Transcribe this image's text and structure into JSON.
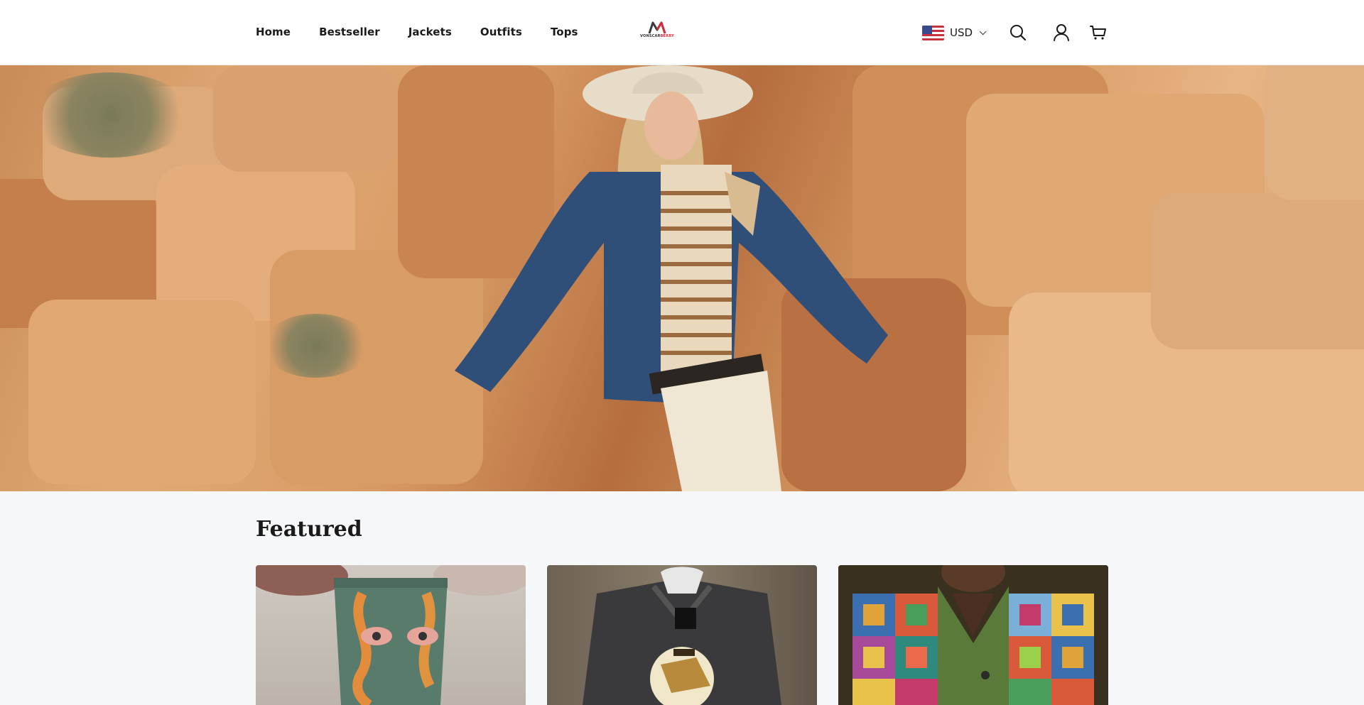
{
  "header": {
    "nav": [
      "Home",
      "Bestseller",
      "Jackets",
      "Outfits",
      "Tops"
    ],
    "logo": {
      "text_dark": "VONSCAR",
      "text_red": "BERRY",
      "mark": "M"
    },
    "currency": {
      "label": "USD",
      "flag": "us-flag-icon"
    },
    "icons": [
      "search-icon",
      "account-icon",
      "cart-icon"
    ]
  },
  "hero": {
    "alt": "hero-banner"
  },
  "featured": {
    "title": "Featured",
    "products": [
      {
        "name": "product-card-1"
      },
      {
        "name": "product-card-2"
      },
      {
        "name": "product-card-3"
      }
    ]
  },
  "colors": {
    "brand_red": "#d62b3a",
    "text": "#1a1a1a",
    "page_bg": "#f6f7f9"
  }
}
